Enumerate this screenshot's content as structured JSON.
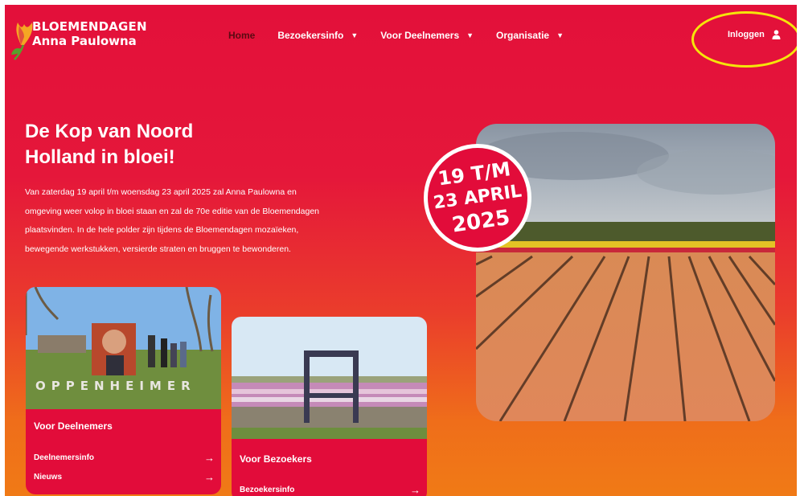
{
  "header": {
    "logo": {
      "line1": "BLOEMENDAGEN",
      "line2": "Anna Paulowna"
    },
    "nav": [
      {
        "label": "Home",
        "has_dropdown": false,
        "active": true
      },
      {
        "label": "Bezoekersinfo",
        "has_dropdown": true,
        "active": false
      },
      {
        "label": "Voor Deelnemers",
        "has_dropdown": true,
        "active": false
      },
      {
        "label": "Organisatie",
        "has_dropdown": true,
        "active": false
      }
    ],
    "login_label": "Inloggen",
    "login_icon": "user-icon"
  },
  "hero": {
    "title_line1": "De Kop van Noord",
    "title_line2": "Holland in bloei!",
    "text_lines": [
      "Van zaterdag 19 april t/m woensdag 23 april 2025 zal Anna Paulowna en",
      "omgeving weer volop in bloei staan en zal de 70e editie van de Bloemendagen",
      "plaatsvinden. In de hele polder zijn tijdens de Bloemendagen mozaïeken,",
      "bewegende werkstukken, versierde straten en bruggen te bewonderen."
    ],
    "badge": {
      "line1": "19 T/M",
      "line2": "23 APRIL",
      "line3": "2025"
    }
  },
  "cards": [
    {
      "title": "Voor Deelnemers",
      "image_text": "OPPENHEIMER",
      "links": [
        {
          "label": "Deelnemersinfo"
        },
        {
          "label": "Nieuws"
        }
      ]
    },
    {
      "title": "Voor Bezoekers",
      "links": [
        {
          "label": "Bezoekersinfo"
        }
      ]
    }
  ],
  "colors": {
    "primary_red": "#e20c3a",
    "orange": "#f07a16",
    "highlight_yellow": "#f5e50a",
    "active_nav": "#5a0a12"
  }
}
